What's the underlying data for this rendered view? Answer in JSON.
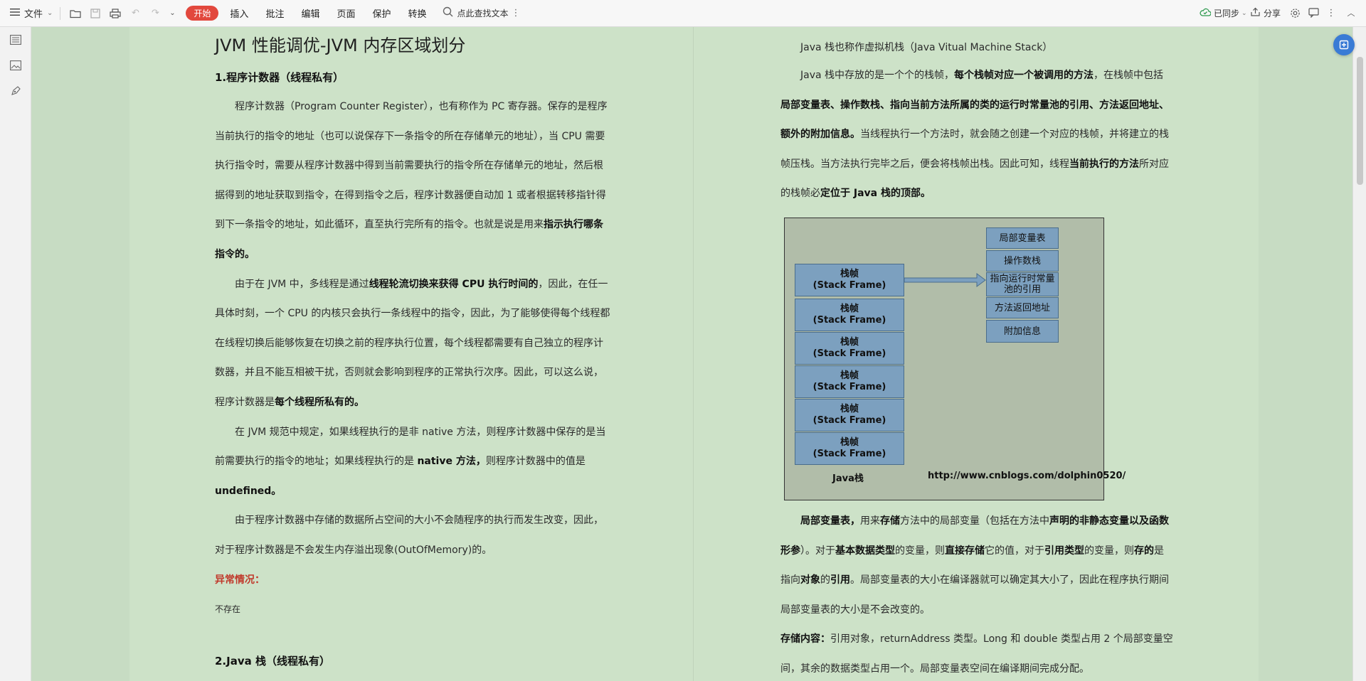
{
  "toolbar": {
    "file_label": "文件",
    "tabs": [
      "开始",
      "插入",
      "批注",
      "编辑",
      "页面",
      "保护",
      "转换"
    ],
    "search_placeholder": "点此查找文本",
    "sync_label": "已同步",
    "share_label": "分享"
  },
  "left_doc": {
    "title": "JVM 性能调优-JVM 内存区域划分",
    "section1_heading": "1.程序计数器（线程私有）",
    "p1_a": "程序计数器（Program Counter Register），也有称作为 PC 寄存器。保存的是程序当前执行的指令的地址（也可以说保存下一条指令的所在存储单元的地址），当 CPU 需要执行指令时，需要从程序计数器中得到当前需要执行的指令所在存储单元的地址，然后根据得到的地址获取到指令，在得到指令之后，程序计数器便自动加 1 或者根据转移指针得到下一条指令的地址，如此循环，直至执行完所有的指令。也就是说是用来",
    "p1_b": "指示执行哪条指令的。",
    "p2_a": "由于在 JVM 中，多线程是通过",
    "p2_b": "线程轮流切换来获得 CPU 执行时间的",
    "p2_c": "，因此，在任一具体时刻，一个 CPU 的内核只会执行一条线程中的指令，因此，为了能够使得每个线程都在线程切换后能够恢复在切换之前的程序执行位置，每个线程都需要有自己独立的程序计数器，并且不能互相被干扰，否则就会影响到程序的正常执行次序。因此，可以这么说，程序计数器是",
    "p2_d": "每个线程所私有的。",
    "p3_a": "在 JVM 规范中规定，如果线程执行的是非 native 方法，则程序计数器中保存的是当前需要执行的指令的地址；如果线程执行的是 ",
    "p3_b": "native 方法，",
    "p3_c": "则程序计数器中的值是 ",
    "p3_d": "undefined。",
    "p4": "由于程序计数器中存储的数据所占空间的大小不会随程序的执行而发生改变，因此，对于程序计数器是不会发生内存溢出现象(OutOfMemory)的。",
    "exception_label": "异常情况：",
    "exception_value": "不存在",
    "section2_heading": "2.Java 栈（线程私有）"
  },
  "right_doc": {
    "p1": "Java 栈也称作虚拟机栈（Java Vitual Machine Stack）",
    "p2_a": "Java 栈中存放的是一个个的栈帧，",
    "p2_b": "每个栈帧对应一个被调用的方法",
    "p2_c": "，在栈帧中包括",
    "p2_d": "局部变量表、操作数栈、指向当前方法所属的类的运行时常量池的引用、方法返回地址、额外的附加信息。",
    "p2_e": "当线程执行一个方法时，就会随之创建一个对应的栈帧，并将建立的栈帧压栈。当方法执行完毕之后，便会将栈帧出栈。因此可知，线程",
    "p2_f": "当前执行的方法",
    "p2_g": "所对应的栈帧必",
    "p2_h": "定位于 Java 栈的顶部。",
    "p3_a": "局部变量表，",
    "p3_b": "用来",
    "p3_c": "存储",
    "p3_d": "方法中的局部变量（包括在方法中",
    "p3_e": "声明的非静态变量以及函数形参",
    "p3_f": "）。对于",
    "p3_g": "基本数据类型",
    "p3_h": "的变量，则",
    "p3_i": "直接存储",
    "p3_j": "它的值，对于",
    "p3_k": "引用类型",
    "p3_l": "的变量，则",
    "p3_m": "存的",
    "p3_n": "是指向",
    "p3_o": "对象",
    "p3_p": "的",
    "p3_q": "引用",
    "p3_r": "。局部变量表的大小在编译器就可以确定其大小了，因此在程序执行期间局部变量表的大小是不会改变的。",
    "p4_a": "存储内容：",
    "p4_b": "引用对象，returnAddress 类型。Long 和 double 类型占用 2 个局部变量空间，其余的数据类型占用一个。局部变量表空间在编译期间完成分配。"
  },
  "diagram": {
    "frame_title": "栈帧",
    "frame_sub": "(Stack  Frame)",
    "frame_sub2": "(Stack Frame)",
    "items": [
      "局部变量表",
      "操作数栈",
      "指向运行时常量池的引用",
      "方法返回地址",
      "附加信息"
    ],
    "stack_label": "Java栈",
    "url": "http://www.cnblogs.com/dolphin0520/"
  }
}
